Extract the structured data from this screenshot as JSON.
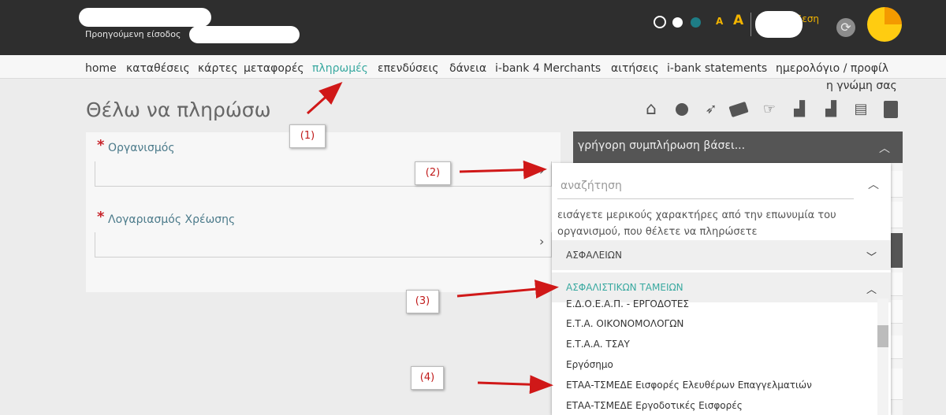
{
  "header": {
    "previous_login_label": "Προηγούμενη είσοδος",
    "font_small": "A",
    "font_large": "A",
    "logout_fragment": "δεση"
  },
  "nav": {
    "items": [
      "home",
      "καταθέσεις",
      "κάρτες",
      "μεταφορές",
      "πληρωμές",
      "επενδύσεις",
      "δάνεια",
      "i-bank 4 Merchants",
      "αιτήσεις",
      "i-bank statements",
      "ημερολόγιο / προφίλ"
    ],
    "active_item": "πληρωμές",
    "extra": "η γνώμη σας"
  },
  "page": {
    "title": "Θέλω να πληρώσω"
  },
  "toolbar": {
    "icons": [
      "home-icon",
      "coins-icon",
      "transfer-icon",
      "cards-icon",
      "touch-payment-icon",
      "investments-chart-icon",
      "loans-chart-icon",
      "requests-icon",
      "contacts-icon"
    ]
  },
  "form": {
    "organization_label": "Οργανισμός",
    "debit_account_label": "Λογαριασμός Χρέωσης",
    "required_mark": "*"
  },
  "quick_fill": {
    "title": "γρήγορη συμπλήρωση βάσει..."
  },
  "dropdown": {
    "search_placeholder": "αναζήτηση",
    "hint": "εισάγετε μερικούς χαρακτήρες από την επωνυμία του οργανισμού, που θέλετε να πληρώσετε",
    "groups": [
      {
        "label": "ΑΣΦΑΛΕΙΩΝ",
        "expanded": false
      },
      {
        "label": "ΑΣΦΑΛΙΣΤΙΚΩΝ ΤΑΜΕΙΩΝ",
        "expanded": true
      }
    ],
    "items": [
      "Ε.Δ.Ο.Ε.Α.Π. - ΕΡΓΟΔΟΤΕΣ",
      "Ε.Τ.Α. ΟΙΚΟΝΟΜΟΛΟΓΩΝ",
      "Ε.Τ.Α.Α. ΤΣΑΥ",
      "Εργόσημο",
      "ΕΤΑΑ-ΤΣΜΕΔΕ Εισφορές Ελευθέρων Επαγγελματιών",
      "ΕΤΑΑ-ΤΣΜΕΔΕ Εργοδοτικές Εισφορές"
    ]
  },
  "annotations": [
    "(1)",
    "(2)",
    "(3)",
    "(4)"
  ],
  "colors": {
    "topbar": "#2e2e2e",
    "accent_teal": "#39a9a0",
    "accent_yellow": "#f2b400",
    "required_red": "#c8252c",
    "annotation_red": "#c01a1a"
  }
}
